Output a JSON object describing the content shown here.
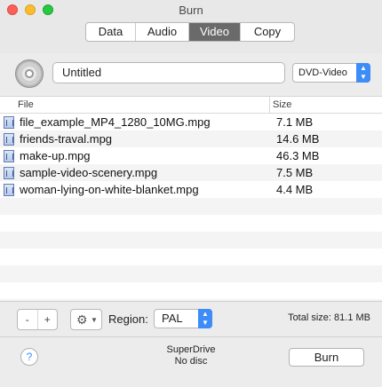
{
  "window": {
    "title": "Burn"
  },
  "tabs": [
    {
      "label": "Data"
    },
    {
      "label": "Audio"
    },
    {
      "label": "Video",
      "active": true
    },
    {
      "label": "Copy"
    }
  ],
  "disc": {
    "name": "Untitled",
    "format": "DVD-Video"
  },
  "filelist": {
    "columns": {
      "file": "File",
      "size": "Size"
    },
    "rows": [
      {
        "name": "file_example_MP4_1280_10MG.mpg",
        "size": "7.1 MB"
      },
      {
        "name": "friends-traval.mpg",
        "size": "14.6 MB"
      },
      {
        "name": "make-up.mpg",
        "size": "46.3 MB"
      },
      {
        "name": "sample-video-scenery.mpg",
        "size": "7.5 MB"
      },
      {
        "name": "woman-lying-on-white-blanket.mpg",
        "size": "4.4 MB"
      }
    ]
  },
  "bottom": {
    "remove_label": "-",
    "add_label": "+",
    "region_label": "Region:",
    "region_value": "PAL",
    "total_size": "Total size: 81.1 MB",
    "drive_name": "SuperDrive",
    "drive_status": "No disc",
    "burn_label": "Burn",
    "help_label": "?"
  },
  "colors": {
    "accent": "#3d8cf7",
    "active_tab": "#6a6a6a"
  },
  "icons": [
    "disc-icon",
    "file-video-icon",
    "gear-icon",
    "help-icon",
    "chevron-updown-icon"
  ]
}
